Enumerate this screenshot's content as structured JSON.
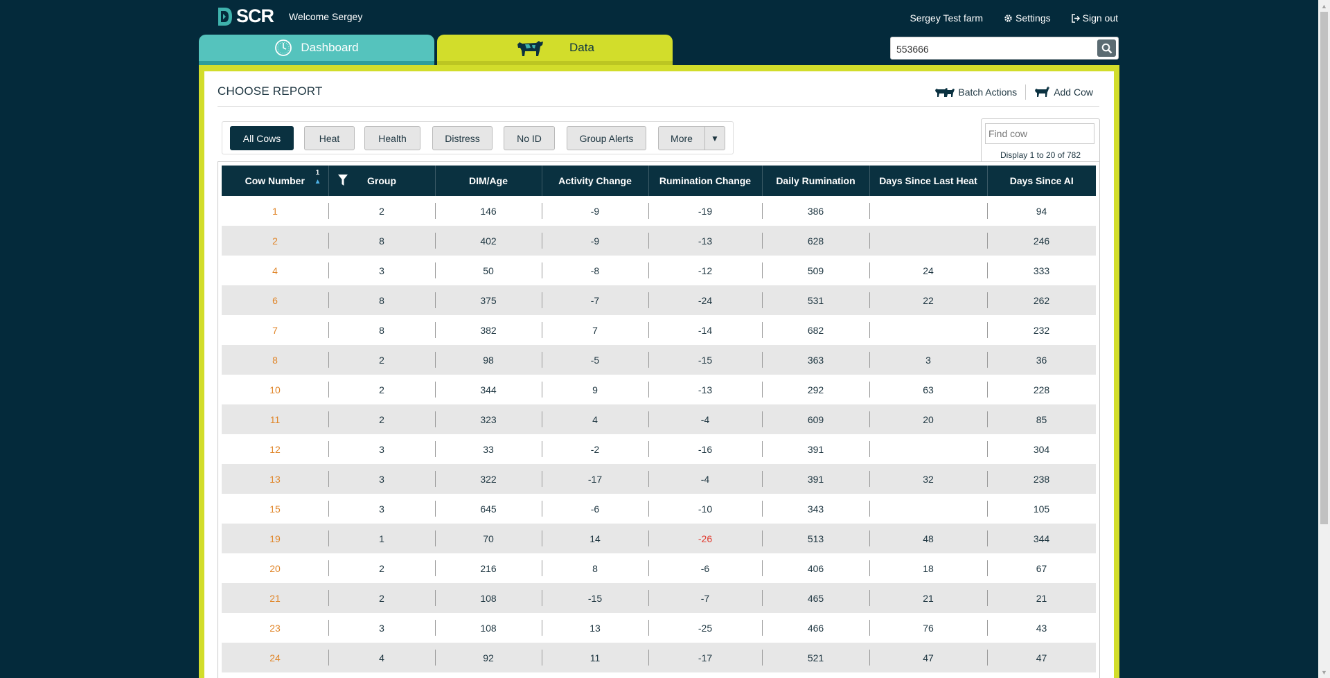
{
  "header": {
    "logo_text": "SCR",
    "welcome": "Welcome Sergey",
    "farm": "Sergey Test farm",
    "settings": "Settings",
    "sign_out": "Sign out"
  },
  "tabs": [
    {
      "label": "Dashboard",
      "icon": "clock-icon"
    },
    {
      "label": "Data",
      "icon": "cow-icon"
    }
  ],
  "search": {
    "value": "553666",
    "icon": "search-icon"
  },
  "panel": {
    "title": "CHOOSE REPORT",
    "batch_actions": "Batch Actions",
    "add_cow": "Add Cow"
  },
  "filters": [
    "All Cows",
    "Heat",
    "Health",
    "Distress",
    "No ID",
    "Group Alerts"
  ],
  "more": {
    "label": "More",
    "arrow": "▼"
  },
  "find": {
    "placeholder": "Find cow",
    "display_info": "Display 1 to 20 of 782"
  },
  "table": {
    "columns": [
      "Cow Number",
      "Group",
      "DIM/Age",
      "Activity Change",
      "Rumination Change",
      "Daily Rumination",
      "Days Since Last Heat",
      "Days Since AI"
    ],
    "sort_index": "1",
    "rows": [
      [
        "1",
        "2",
        "146",
        "-9",
        "-19",
        "386",
        "",
        "94"
      ],
      [
        "2",
        "8",
        "402",
        "-9",
        "-13",
        "628",
        "",
        "246"
      ],
      [
        "4",
        "3",
        "50",
        "-8",
        "-12",
        "509",
        "24",
        "333"
      ],
      [
        "6",
        "8",
        "375",
        "-7",
        "-24",
        "531",
        "22",
        "262"
      ],
      [
        "7",
        "8",
        "382",
        "7",
        "-14",
        "682",
        "",
        "232"
      ],
      [
        "8",
        "2",
        "98",
        "-5",
        "-15",
        "363",
        "3",
        "36"
      ],
      [
        "10",
        "2",
        "344",
        "9",
        "-13",
        "292",
        "63",
        "228"
      ],
      [
        "11",
        "2",
        "323",
        "4",
        "-4",
        "609",
        "20",
        "85"
      ],
      [
        "12",
        "3",
        "33",
        "-2",
        "-16",
        "391",
        "",
        "304"
      ],
      [
        "13",
        "3",
        "322",
        "-17",
        "-4",
        "391",
        "32",
        "238"
      ],
      [
        "15",
        "3",
        "645",
        "-6",
        "-10",
        "343",
        "",
        "105"
      ],
      [
        "19",
        "1",
        "70",
        "14",
        "-26",
        "513",
        "48",
        "344"
      ],
      [
        "20",
        "2",
        "216",
        "8",
        "-6",
        "406",
        "18",
        "67"
      ],
      [
        "21",
        "2",
        "108",
        "-15",
        "-7",
        "465",
        "21",
        "21"
      ],
      [
        "23",
        "3",
        "108",
        "13",
        "-25",
        "466",
        "76",
        "43"
      ],
      [
        "24",
        "4",
        "92",
        "11",
        "-17",
        "521",
        "47",
        "47"
      ]
    ],
    "alert_cells": [
      [
        11,
        4
      ]
    ]
  },
  "colors": {
    "background": "#042a3b",
    "dashboard_tab": "#55c3bd",
    "data_tab": "#d2dd2b",
    "table_header": "#0a3140",
    "cow_number": "#e0862a",
    "alert": "#e03a2f"
  }
}
